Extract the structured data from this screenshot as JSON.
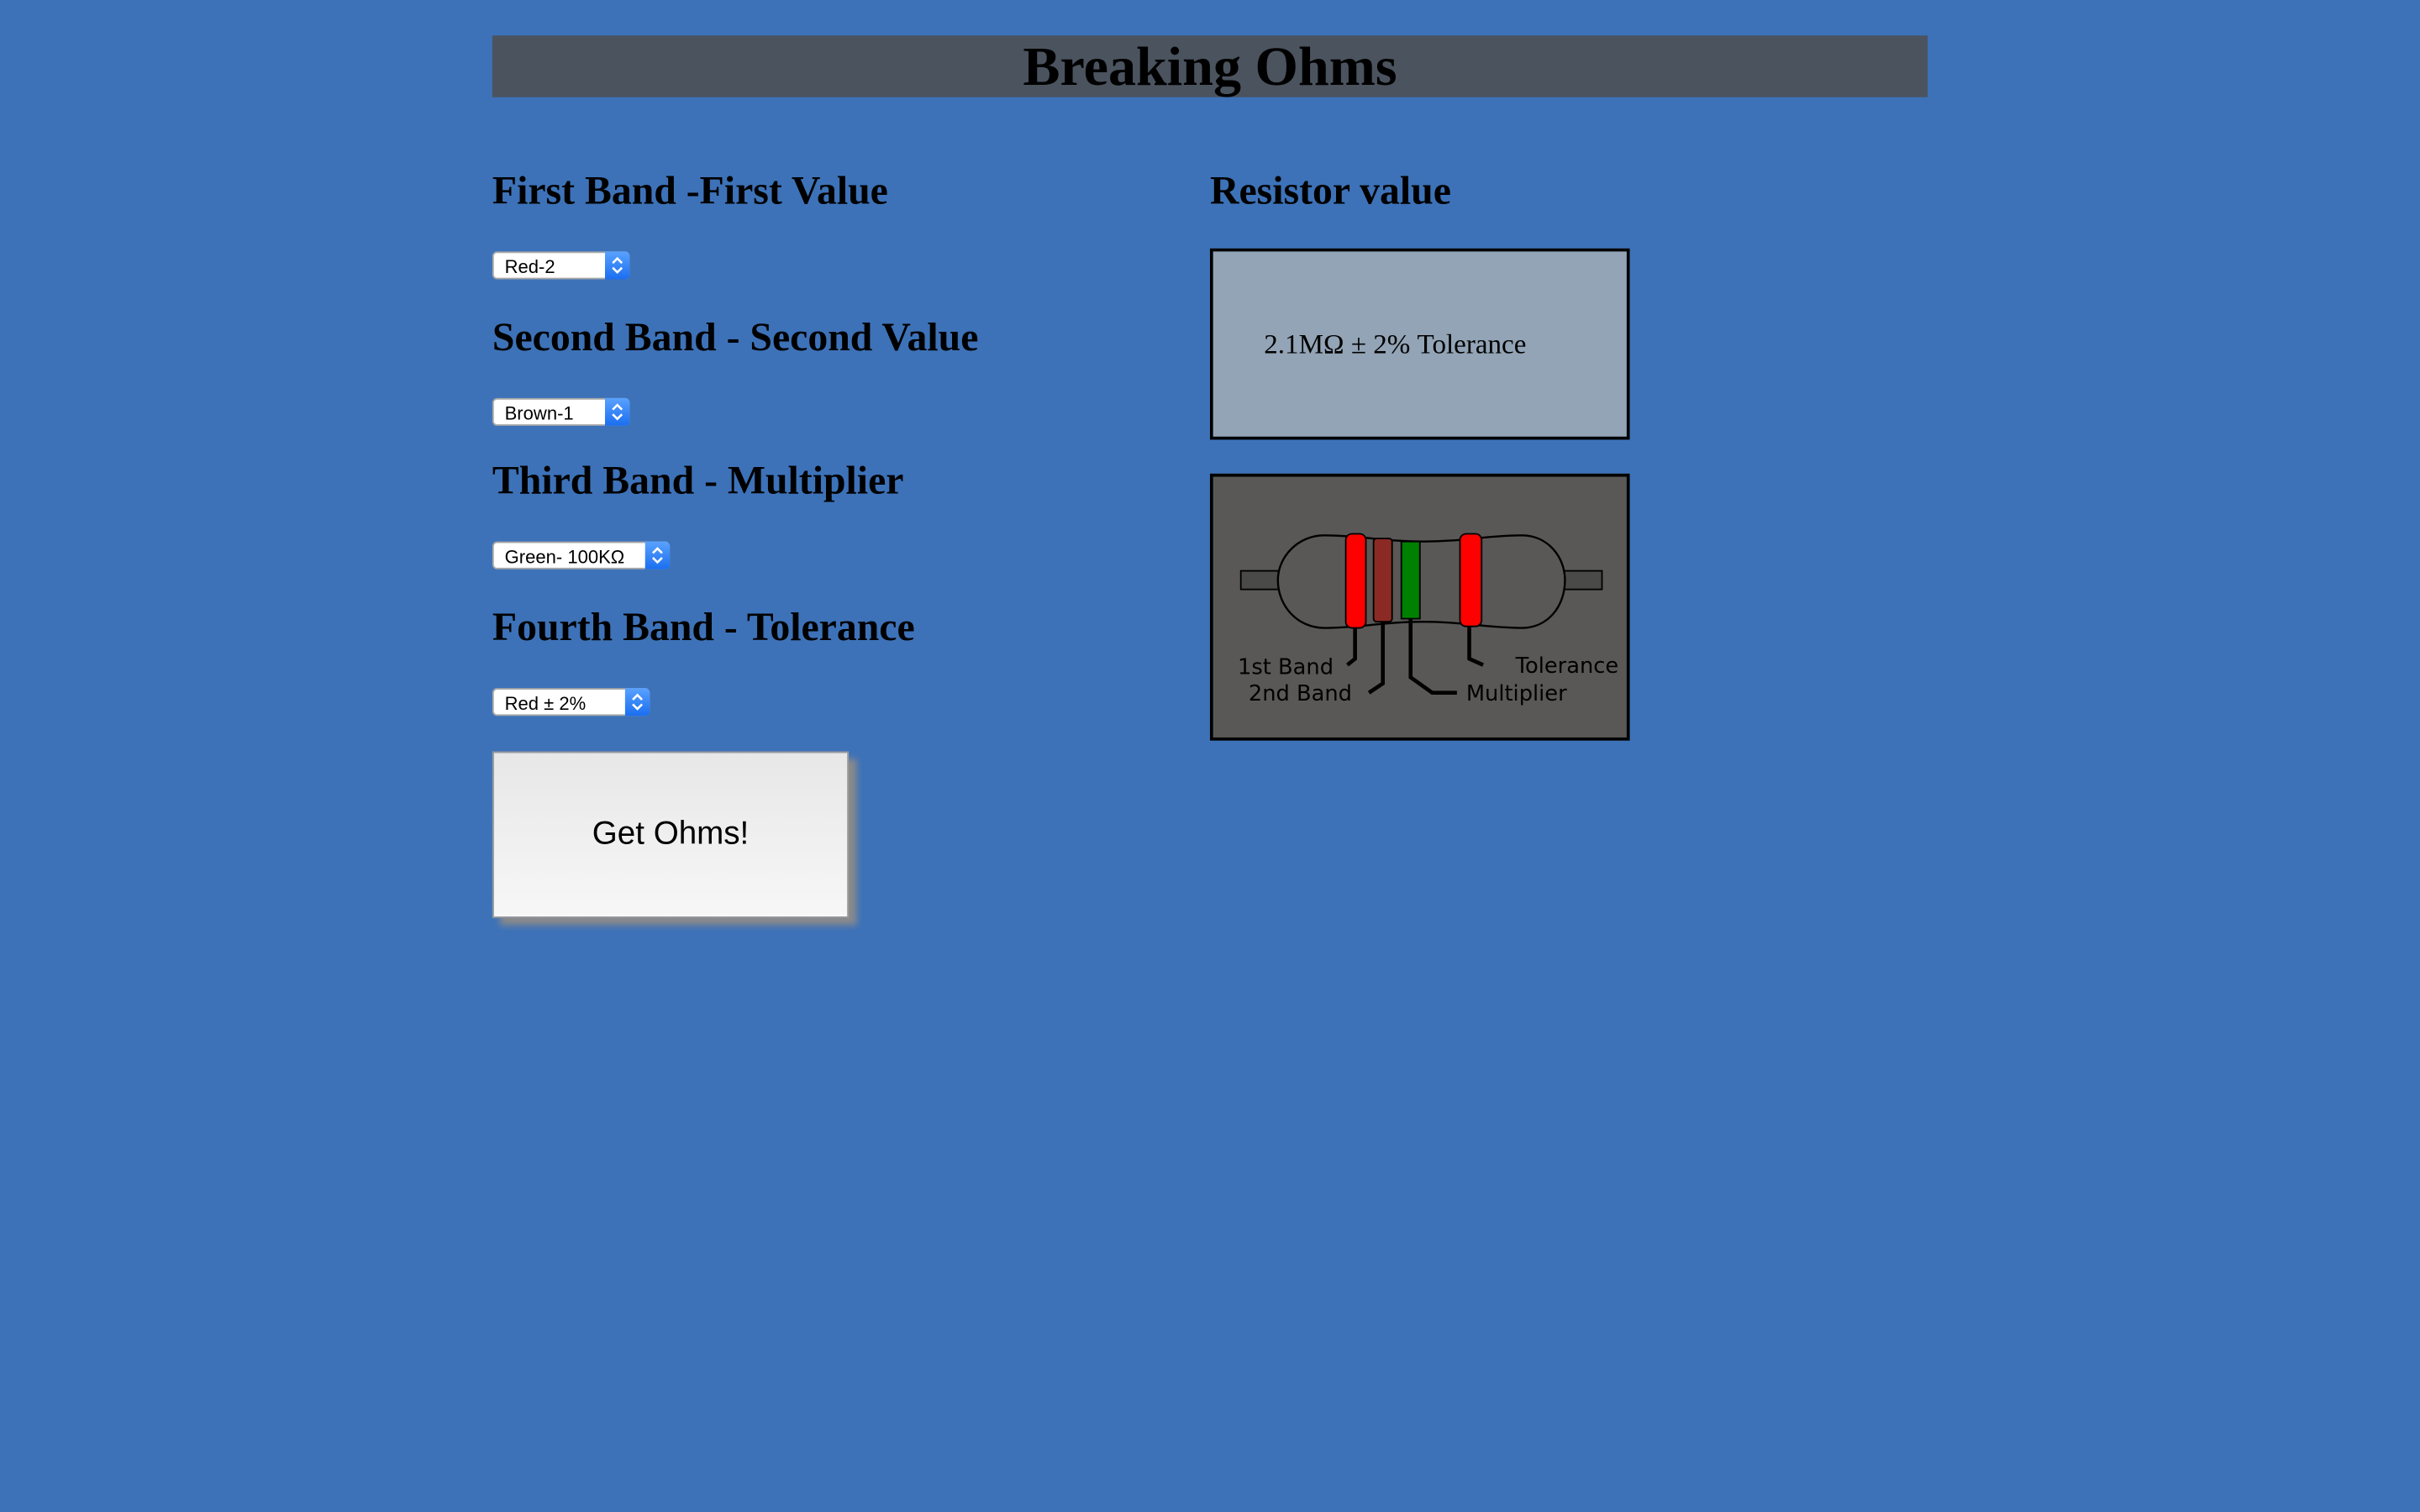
{
  "app": {
    "title": "Breaking Ohms"
  },
  "bands": [
    {
      "label": "First Band -First Value",
      "selected": "Red-2"
    },
    {
      "label": "Second Band - Second Value",
      "selected": "Brown-1"
    },
    {
      "label": "Third Band - Multiplier",
      "selected": "Green- 100KΩ"
    },
    {
      "label": "Fourth Band - Tolerance",
      "selected": "Red ± 2%"
    }
  ],
  "button": {
    "label": "Get Ohms!"
  },
  "result": {
    "heading": "Resistor value",
    "text": "2.1MΩ ± 2% Tolerance"
  },
  "diagram": {
    "labels": {
      "band1": "1st Band",
      "band2": "2nd Band",
      "multiplier": "Multiplier",
      "tolerance": "Tolerance"
    },
    "band_colors": {
      "band1": "#ff0000",
      "band2": "#8b2a24",
      "multiplier": "#008000",
      "tolerance": "#ff0000"
    }
  },
  "icons": {
    "select_arrow": "up-down-chevron-icon"
  }
}
